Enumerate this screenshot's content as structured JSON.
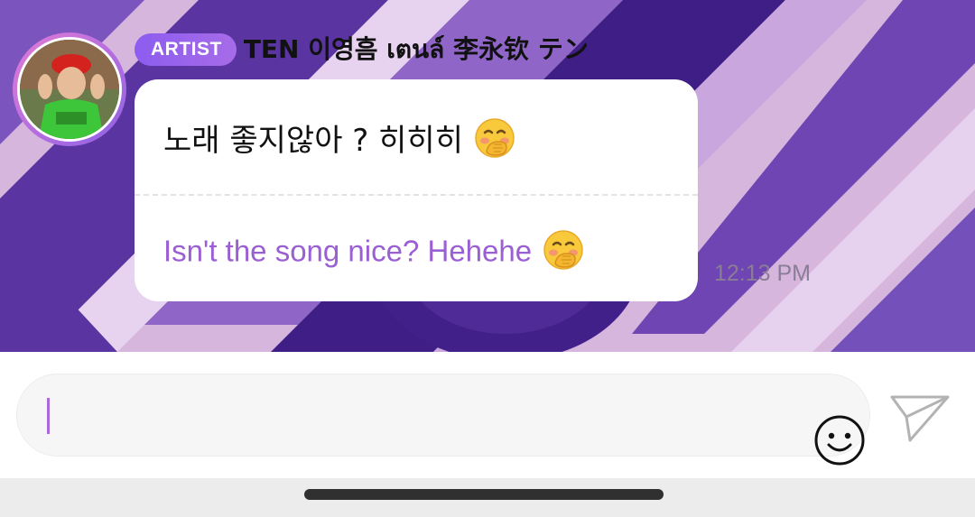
{
  "sender": {
    "badge": "ARTIST",
    "name": "TEN 이영흠 เตนล์ 李永钦 テン"
  },
  "message": {
    "original": "노래 좋지않아 ? 히히히",
    "translation": "Isn't the song nice? Hehehe",
    "emoji": "hand-over-mouth-emoji",
    "time": "12:13 PM"
  },
  "composer": {
    "input_value": "",
    "emoji_button_icon": "smiley-icon",
    "send_button_icon": "send-icon"
  },
  "colors": {
    "badge": "#8d5df0",
    "translation": "#9a5fd3",
    "bubble": "#ffffff",
    "bg_light": "#e0c7eb",
    "bg_dark": "#4a2890"
  }
}
